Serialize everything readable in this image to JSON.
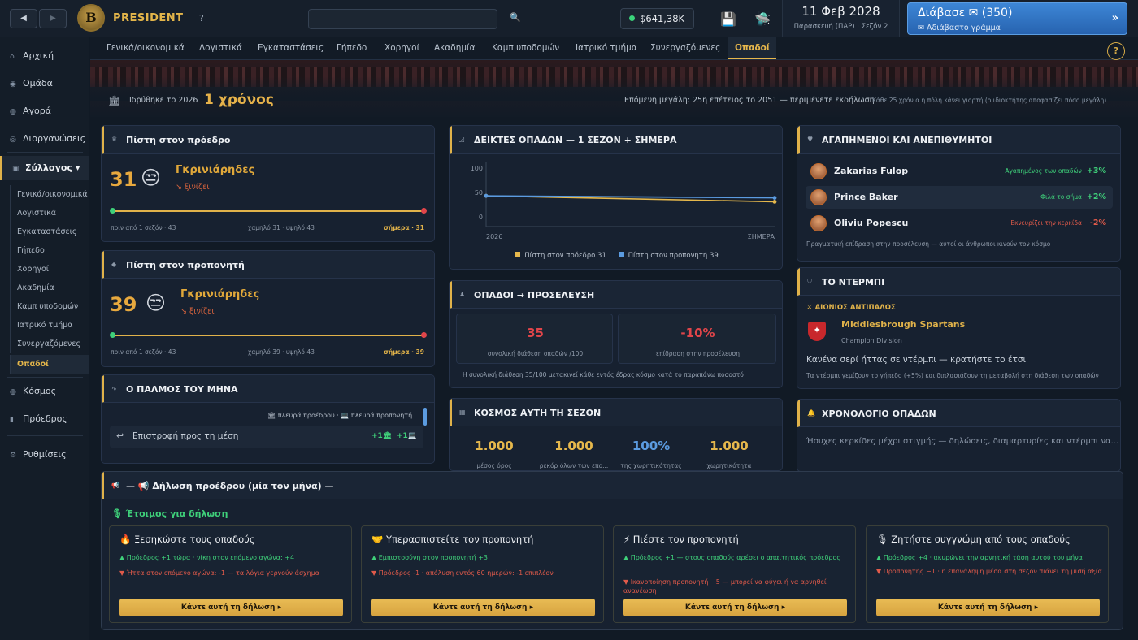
{
  "topbar": {
    "brand": "PRESIDENT",
    "help": "?",
    "money": "$641,38K",
    "date": "11 Φεβ 2028",
    "date_sub": "Παρασκευή (ΠΑΡ) · Σεζόν 2",
    "read_label": "Διάβασε ✉ (350)",
    "read_sub": "✉ Αδιάβαστο γράμμα",
    "read_arrow": "»",
    "back": "◀",
    "forward": "▶",
    "search_icon": "🔍",
    "save_icon": "💾",
    "ufo_icon": "🛸"
  },
  "sidebar": {
    "items": [
      {
        "label": "Αρχική",
        "icon": "⌂"
      },
      {
        "label": "Ομάδα",
        "icon": "◉"
      },
      {
        "label": "Αγορά",
        "icon": "◍"
      },
      {
        "label": "Διοργανώσεις",
        "icon": "◎"
      },
      {
        "label": "Σύλλογος ▾",
        "icon": "▣"
      },
      {
        "label": "Κόσμος",
        "icon": "◍"
      },
      {
        "label": "Πρόεδρος",
        "icon": "▮"
      },
      {
        "label": "Ρυθμίσεις",
        "icon": "⚙"
      }
    ],
    "sub": [
      "Γενικά/οικονομικά",
      "Λογιστικά",
      "Εγκαταστάσεις",
      "Γήπεδο",
      "Χορηγοί",
      "Ακαδημία",
      "Καμπ υποδομών",
      "Ιατρικό τμήμα",
      "Συνεργαζόμενες",
      "Οπαδοί"
    ]
  },
  "tabs": [
    "Γενικά/οικονομικά",
    "Λογιστικά",
    "Εγκαταστάσεις",
    "Γήπεδο",
    "Χορηγοί",
    "Ακαδημία",
    "Καμπ υποδομών",
    "Ιατρικό τμήμα",
    "Συνεργαζόμενες",
    "Οπαδοί"
  ],
  "header": {
    "founded": "Ιδρύθηκε το 2026",
    "age": "1 χρόνος",
    "next_big": "Επόμενη μεγάλη: 25η επέτειος το 2051 — περιμένετε εκδήλωση",
    "every25": "Κάθε 25 χρόνια η πόλη κάνει γιορτή (ο ιδιοκτήτης αποφασίζει πόσο μεγάλη)",
    "help": "?"
  },
  "faith_president": {
    "title": "Πίστη στον πρόεδρο",
    "value": "31",
    "face": "😒",
    "mood": "Γκρινιάρηδες",
    "trend": "↘ ξινίζει",
    "ago": "πριν από 1 σεζόν · 43",
    "range": "χαμηλό 31 · υψηλό 43",
    "today": "σήμερα · 31"
  },
  "faith_coach": {
    "title": "Πίστη στον προπονητή",
    "value": "39",
    "face": "😒",
    "mood": "Γκρινιάρηδες",
    "trend": "↘ ξινίζει",
    "ago": "πριν από 1 σεζόν · 43",
    "range": "χαμηλό 39 · υψηλό 43",
    "today": "σήμερα · 39"
  },
  "pulse": {
    "title": "Ο ΠΑΛΜΟΣ ΤΟΥ ΜΗΝΑ",
    "legend": "🏛 πλευρά προέδρου · 💻 πλευρά προπονητή",
    "row_label": "Επιστροφή προς τη μέση",
    "row_icon": "↩",
    "badge1": "+1🏛",
    "badge2": "+1💻"
  },
  "chart_data": {
    "type": "line",
    "title": "ΔΕΙΚΤΕΣ ΟΠΑΔΩΝ — 1 ΣΕΖΟΝ + ΣΗΜΕΡΑ",
    "x": [
      "2026",
      "ΣΗΜΕΡΑ"
    ],
    "yticks": [
      "100",
      "50",
      "0"
    ],
    "ylim": [
      0,
      100
    ],
    "series": [
      {
        "name": "Πίστη στον πρόεδρο 31",
        "values": [
          43,
          31
        ],
        "color": "#e6b84c"
      },
      {
        "name": "Πίστη στον προπονητή 39",
        "values": [
          43,
          39
        ],
        "color": "#5b9be0"
      }
    ],
    "grid": false,
    "legend": "bottom"
  },
  "fans_attendance": {
    "title": "ΟΠΑΔΟΙ → ΠΡΟΣΕΛΕΥΣΗ",
    "v1": "35",
    "l1": "συνολική διάθεση οπαδών /100",
    "v2": "-10%",
    "l2": "επίδραση στην προσέλευση",
    "note": "Η συνολική διάθεση 35/100 μετακινεί κάθε εντός έδρας κόσμο κατά το παραπάνω ποσοστό"
  },
  "crowd_season": {
    "title": "ΚΟΣΜΟΣ ΑΥΤΗ ΤΗ ΣΕΖΟΝ",
    "stats": [
      {
        "value": "1.000",
        "label": "μέσος όρος",
        "color": "#e6b84c"
      },
      {
        "value": "1.000",
        "label": "ρεκόρ όλων των επο...",
        "color": "#e6b84c"
      },
      {
        "value": "100%",
        "label": "της χωρητικότητας",
        "color": "#5b9be0"
      },
      {
        "value": "1.000",
        "label": "χωρητικότητα",
        "color": "#e6b84c"
      }
    ]
  },
  "favorites": {
    "title": "ΑΓΑΠΗΜΕΝΟΙ ΚΑΙ ΑΝΕΠΙΘΥΜΗΤΟΙ",
    "rows": [
      {
        "name": "Zakarias Fulop",
        "role": "Αγαπημένος των οπαδών",
        "delta": "+3%",
        "color": "#3fd07a"
      },
      {
        "name": "Prince Baker",
        "role": "Φιλά το σήμα",
        "delta": "+2%",
        "color": "#3fd07a"
      },
      {
        "name": "Oliviu Popescu",
        "role": "Εκνευρίζει την κερκίδα",
        "delta": "-2%",
        "color": "#e05a4a"
      }
    ],
    "note": "Πραγματική επίδραση στην προσέλευση — αυτοί οι άνθρωποι κινούν τον κόσμο"
  },
  "derby": {
    "title": "ΤΟ ΝΤΕΡΜΠΙ",
    "rival_label": "⚔ ΑΙΩΝΙΟΣ ΑΝΤΙΠΑΛΟΣ",
    "rival_name": "Middlesbrough Spartans",
    "division": "Champion Division",
    "streak": "Κανένα σερί ήττας σε ντέρμπι — κρατήστε το έτσι",
    "note": "Τα ντέρμπι γεμίζουν το γήπεδο (+5%) και διπλασιάζουν τη μεταβολή στη διάθεση των οπαδών"
  },
  "timeline": {
    "title": "ΧΡΟΝΟΛΟΓΙΟ ΟΠΑΔΩΝ",
    "text": "Ήσυχες κερκίδες μέχρι στιγμής — δηλώσεις, διαμαρτυρίες και ντέρμπι να..."
  },
  "declaration": {
    "title": "— 📢 Δήλωση προέδρου (μία τον μήνα) —",
    "ready": "Έτοιμος για δήλωση",
    "cards": [
      {
        "icon": "🔥",
        "title": "Ξεσηκώστε τους οπαδούς",
        "pos": "▲ Πρόεδρος +1 τώρα · νίκη στον επόμενο αγώνα: +4",
        "neg": "▼ Ήττα στον επόμενο αγώνα: -1 — τα λόγια γερνούν άσχημα",
        "btn": "Κάντε αυτή τη δήλωση ▸"
      },
      {
        "icon": "🤝",
        "title": "Υπερασπιστείτε τον προπονητή",
        "pos": "▲ Εμπιστοσύνη στον προπονητή +3",
        "neg": "▼ Πρόεδρος -1 · απόλυση εντός 60 ημερών: -1 επιπλέον",
        "btn": "Κάντε αυτή τη δήλωση ▸"
      },
      {
        "icon": "⚡",
        "title": "Πιέστε τον προπονητή",
        "pos": "▲ Πρόεδρος +1 — στους οπαδούς αρέσει ο απαιτητικός πρόεδρος",
        "neg": "▼ Ικανοποίηση προπονητή −5 — μπορεί να φύγει ή να αρνηθεί ανανέωση",
        "btn": "Κάντε αυτή τη δήλωση ▸"
      },
      {
        "icon": "🎙",
        "title": "Ζητήστε συγγνώμη από τους οπαδούς",
        "pos": "▲ Πρόεδρος +4 · ακυρώνει την αρνητική τάση αυτού του μήνα",
        "neg": "▼ Προπονητής −1 · η επανάληψη μέσα στη σεζόν πιάνει τη μισή αξία",
        "btn": "Κάντε αυτή τη δήλωση ▸"
      }
    ]
  }
}
